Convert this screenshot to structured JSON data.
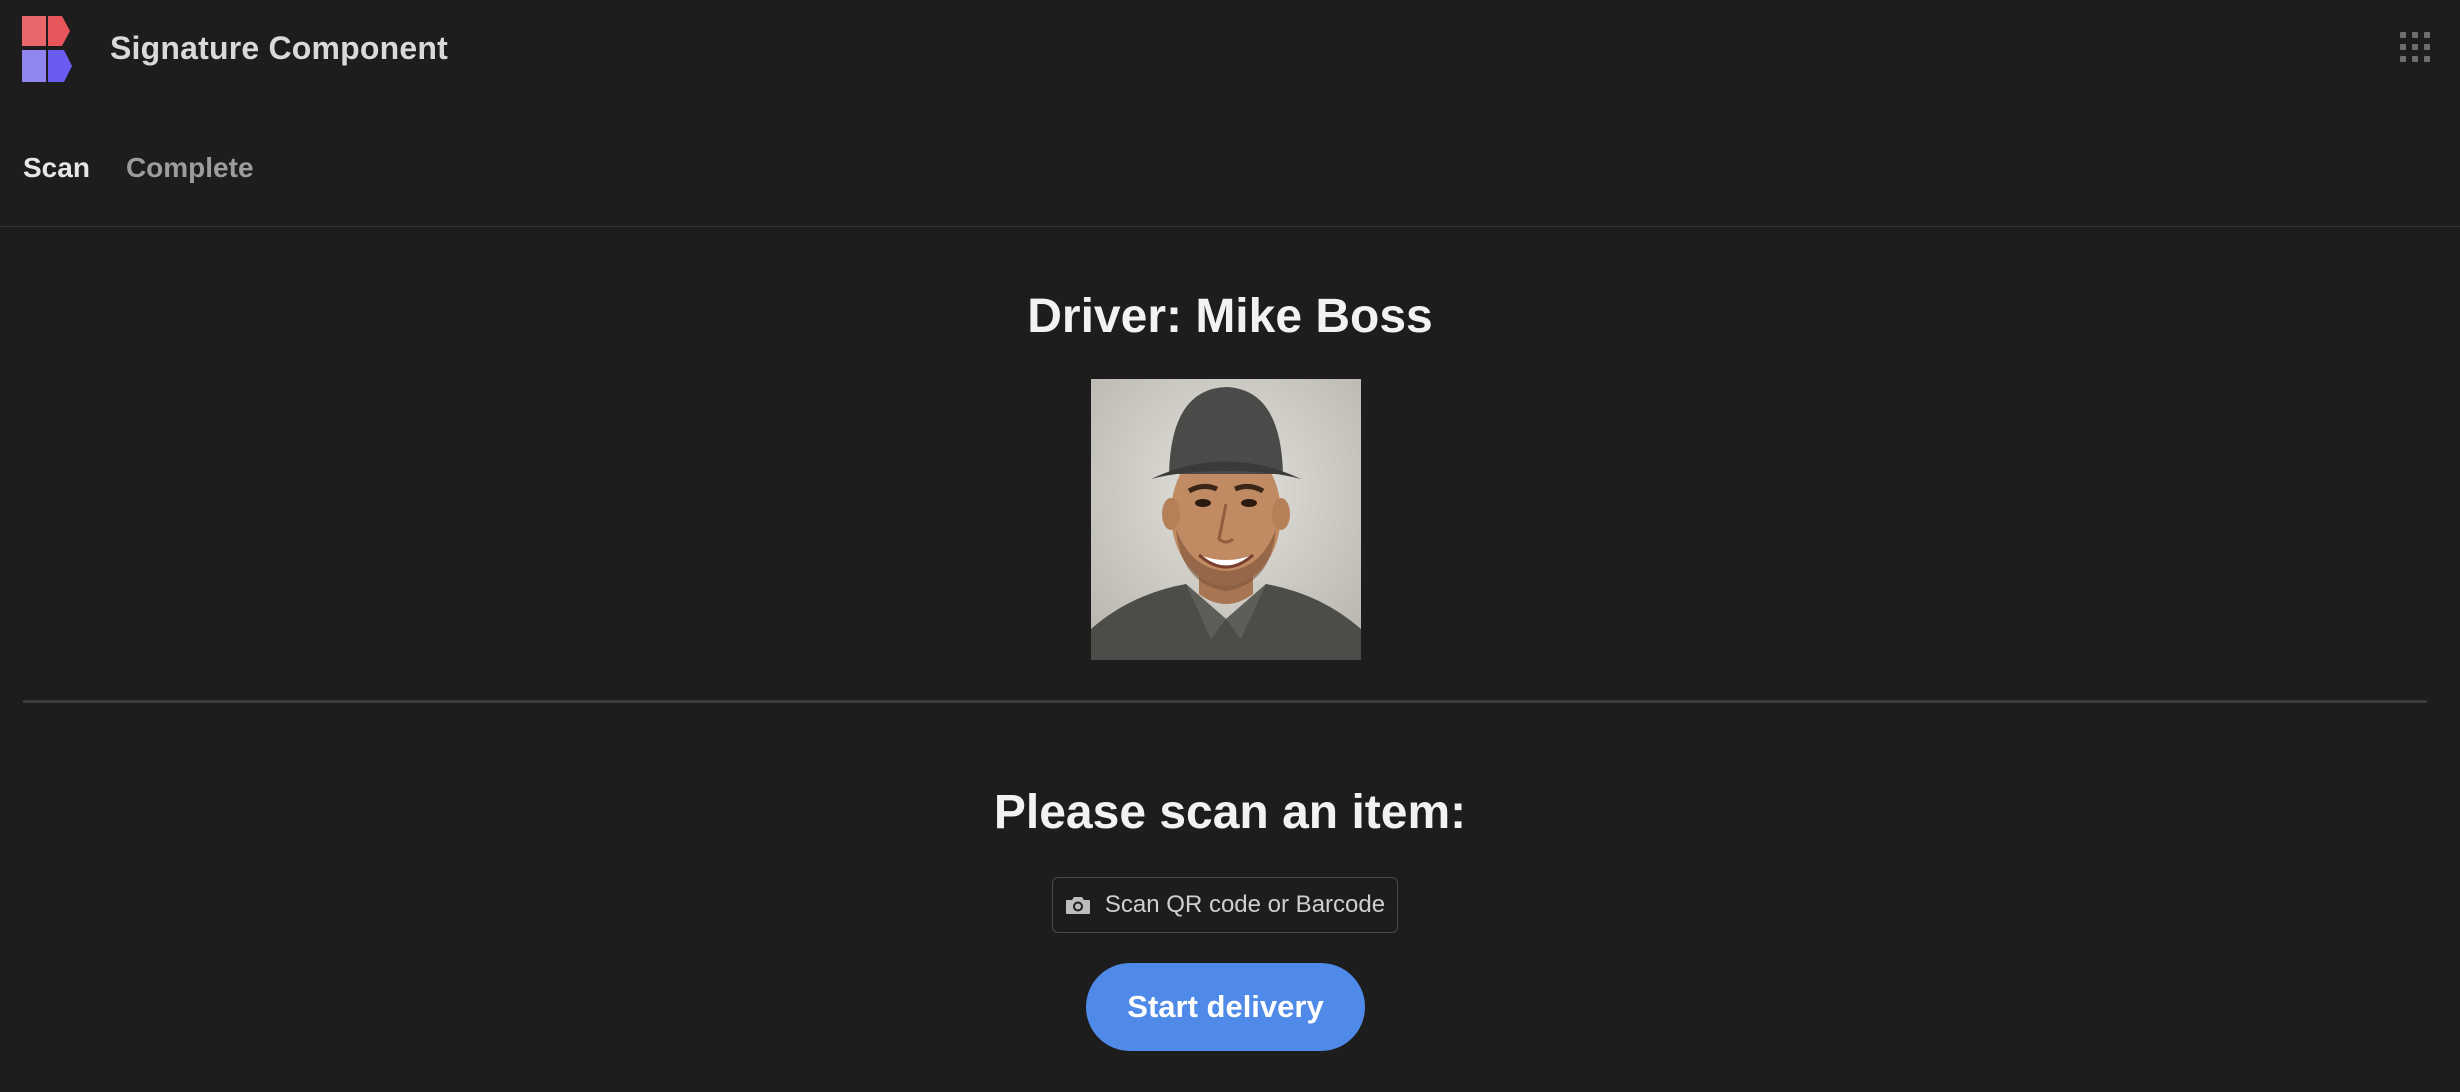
{
  "header": {
    "title": "Signature Component",
    "logo_icon": "app-logo-icon",
    "apps_icon": "apps-grid-icon"
  },
  "tabs": [
    {
      "label": "Scan",
      "active": true
    },
    {
      "label": "Complete",
      "active": false
    }
  ],
  "driver": {
    "heading": "Driver: Mike Boss",
    "photo_icon": "driver-photo"
  },
  "scan": {
    "heading": "Please scan an item:",
    "button_label": "Scan QR code or Barcode",
    "button_icon": "camera-icon"
  },
  "actions": {
    "start_label": "Start delivery"
  },
  "colors": {
    "background": "#1d1d1d",
    "primary_button": "#4f8ae8",
    "logo_red": "#e8676b",
    "logo_purple": "#7b6cf0"
  }
}
